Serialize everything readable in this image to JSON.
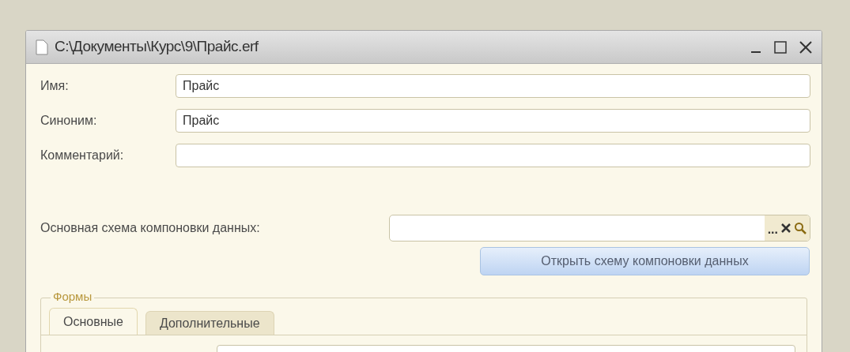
{
  "window": {
    "title": "C:\\Документы\\Курс\\9\\Прайс.erf"
  },
  "fields": [
    {
      "label": "Имя:",
      "value": "Прайс"
    },
    {
      "label": "Синоним:",
      "value": "Прайс"
    },
    {
      "label": "Комментарий:"
    }
  ],
  "schema": {
    "label": "Основная схема компоновки данных:",
    "select_button": "...",
    "open_button": "Открыть схему компоновки данных"
  },
  "forms_group": {
    "title": "Формы",
    "tabs": [
      {
        "label": "Основные",
        "selected": true
      },
      {
        "label": "Дополнительные",
        "selected": false
      }
    ]
  }
}
